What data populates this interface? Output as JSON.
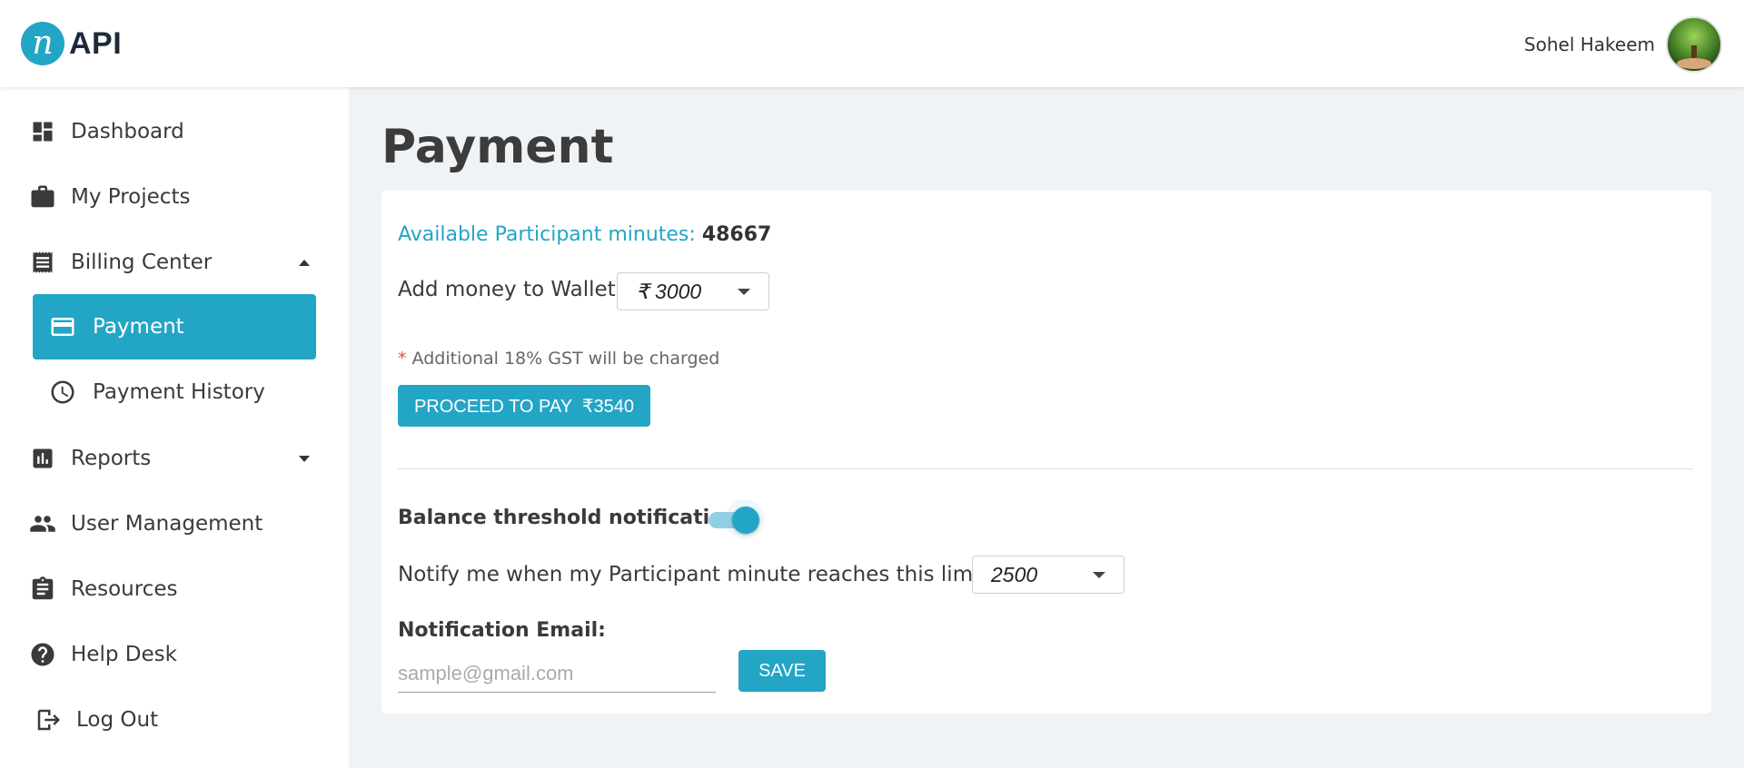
{
  "header": {
    "logo_mark": "n",
    "logo_text": "API",
    "user_name": "Sohel Hakeem"
  },
  "sidebar": {
    "items": [
      {
        "label": "Dashboard",
        "icon": "dashboard-icon"
      },
      {
        "label": "My Projects",
        "icon": "briefcase-icon"
      },
      {
        "label": "Billing Center",
        "icon": "receipt-icon",
        "expanded": true
      },
      {
        "label": "Payment",
        "icon": "credit-card-icon",
        "active": true
      },
      {
        "label": "Payment History",
        "icon": "clock-icon"
      },
      {
        "label": "Reports",
        "icon": "bar-chart-icon",
        "expanded": false
      },
      {
        "label": "User Management",
        "icon": "people-icon"
      },
      {
        "label": "Resources",
        "icon": "clipboard-icon"
      },
      {
        "label": "Help Desk",
        "icon": "help-icon"
      },
      {
        "label": "Log Out",
        "icon": "logout-icon"
      }
    ]
  },
  "page": {
    "title": "Payment"
  },
  "payment": {
    "available_label": "Available Participant minutes:",
    "available_value": "48667",
    "wallet_label": "Add money to Wallet:",
    "wallet_amount": "₹ 3000",
    "gst_star": "*",
    "gst_note": "Additional 18% GST will be charged",
    "proceed_label": "PROCEED TO PAY  ₹3540"
  },
  "notification": {
    "threshold_label": "Balance threshold notification",
    "threshold_enabled": true,
    "limit_label": "Notify me when my Participant minute reaches this limit:",
    "limit_value": "2500",
    "email_label": "Notification Email:",
    "email_value": "",
    "email_placeholder": "sample@gmail.com",
    "save_label": "SAVE"
  },
  "colors": {
    "accent": "#23a5c6",
    "background": "#f0f3f6",
    "required_star": "#d9534f"
  }
}
